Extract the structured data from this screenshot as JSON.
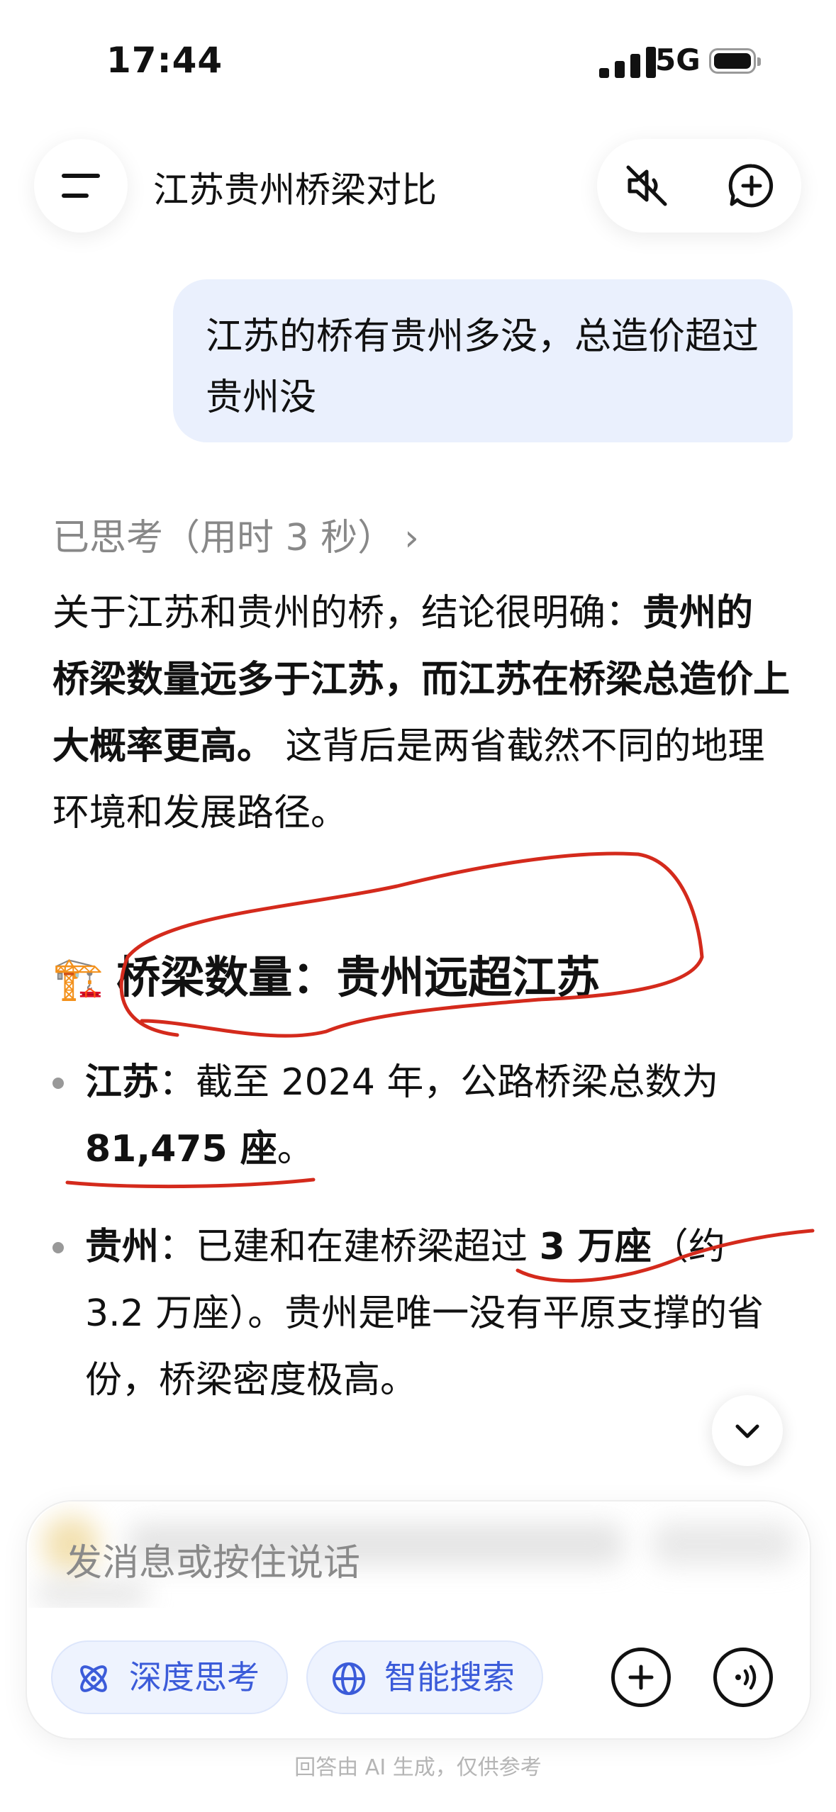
{
  "status_bar": {
    "time": "17:44",
    "network": "5G"
  },
  "header": {
    "title": "江苏贵州桥梁对比"
  },
  "user_message": {
    "text": "江苏的桥有贵州多没，总造价超过贵州没"
  },
  "thinking": {
    "label": "已思考（用时 3 秒）"
  },
  "answer": {
    "intro_plain_1": "关于江苏和贵州的桥，结论很明确：",
    "intro_bold": "贵州的桥梁数量远多于江苏，而江苏在桥梁总造价上大概率更高。",
    "intro_plain_2": " 这背后是两省截然不同的地理环境和发展路径。",
    "heading_icon": "🏗️",
    "heading_text": "桥梁数量：贵州远超江苏",
    "bullets": [
      {
        "name": "江苏",
        "sep": "：",
        "text_1": "截至 2024 年，公路桥梁总数为 ",
        "bold": "81,475 座",
        "text_2": "。"
      },
      {
        "name": "贵州",
        "sep": "：",
        "text_1": "已建和在建桥梁超过 ",
        "bold": "3 万座",
        "text_2": "（约 3.2 万座）。贵州是唯一没有平原支撑的省份，桥梁密度极高。"
      }
    ]
  },
  "composer": {
    "placeholder": "发消息或按住说话",
    "chip_deep_think": "深度思考",
    "chip_smart_search": "智能搜索"
  },
  "footer_note": "回答由 AI 生成，仅供参考",
  "colors": {
    "accent": "#3b5bd9",
    "bubble": "#eaf0fd",
    "annotation": "#d42a1c"
  }
}
